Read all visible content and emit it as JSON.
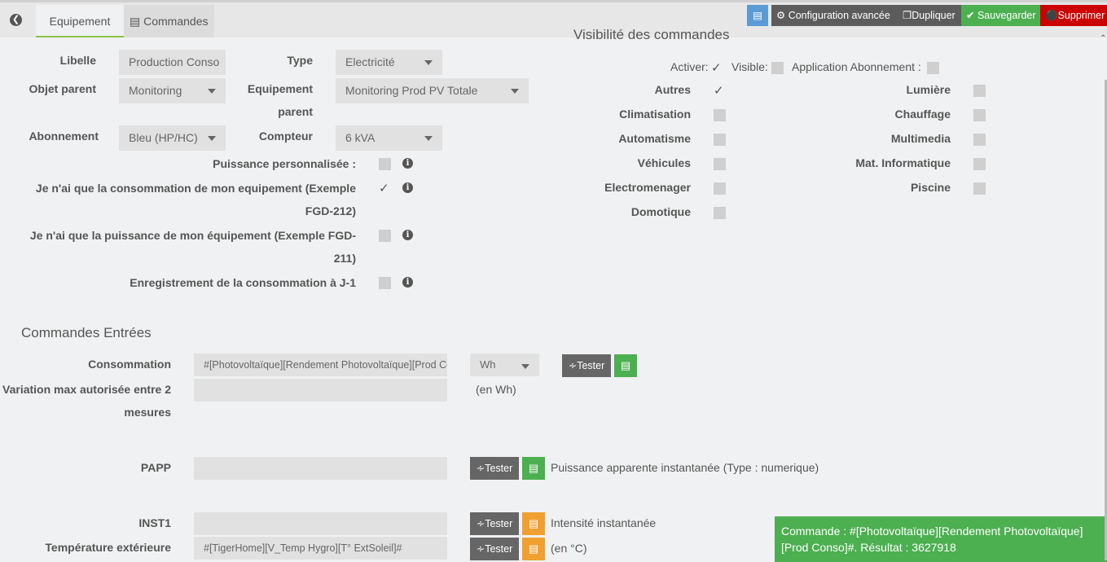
{
  "tabs": {
    "equipement": "Equipement",
    "commandes": "Commandes"
  },
  "toolbar": {
    "config": "Configuration avancée",
    "dupliquer": "Dupliquer",
    "sauvegarder": "Sauvegarder",
    "supprimer": "Supprimer"
  },
  "form": {
    "libelle_label": "Libelle",
    "libelle_value": "Production Conso",
    "type_label": "Type",
    "type_value": "Electricité",
    "objet_label": "Objet parent",
    "objet_value": "Monitoring",
    "equip_label1": "Equipement",
    "equip_label2": "parent",
    "equip_value": "Monitoring Prod PV Totale",
    "abonnement_label": "Abonnement",
    "abonnement_value": "Bleu (HP/HC)",
    "compteur_label": "Compteur",
    "compteur_value": "6 kVA",
    "options": [
      {
        "l1": "Puissance personnalisée :",
        "l2": "",
        "checked": false
      },
      {
        "l1": "Je n'ai que la consommation de mon equipement (Exemple",
        "l2": "FGD-212)",
        "checked": true
      },
      {
        "l1": "Je n'ai que la puissance de mon équipement (Exemple FGD-",
        "l2": "211)",
        "checked": false
      },
      {
        "l1": "Enregistrement de la consommation à J-1",
        "l2": "",
        "checked": false
      }
    ]
  },
  "visibility": {
    "title": "Visibilité des commandes",
    "activer": "Activer:",
    "visible": "Visible:",
    "application": "Application Abonnement :",
    "left": [
      "Autres",
      "Climatisation",
      "Automatisme",
      "Véhicules",
      "Electromenager",
      "Domotique"
    ],
    "right": [
      "Lumière",
      "Chauffage",
      "Multimedia",
      "Mat. Informatique",
      "Piscine"
    ]
  },
  "commandes": {
    "title": "Commandes Entrées",
    "tester": "Tester",
    "consommation_label": "Consommation",
    "consommation_value": "#[Photovoltaïque][Rendement Photovoltaïque][Prod Conso]#",
    "unit": "Wh",
    "variation_label1": "Variation max autorisée entre 2",
    "variation_label2": "mesures",
    "variation_note": "(en Wh)",
    "papp_label": "PAPP",
    "papp_note": "Puissance apparente instantanée (Type : numerique)",
    "inst1_label": "INST1",
    "inst1_note": "Intensité instantanée",
    "temp_label": "Température extérieure",
    "temp_value": "#[TigerHome][V_Temp  Hygro][T° ExtSoleil]#",
    "temp_note": "(en °C)"
  },
  "toast": {
    "line1": "Commande : #[Photovoltaïque][Rendement Photovoltaïque]",
    "line2": "[Prod Conso]#. Résultat : 3627918"
  },
  "colors": {
    "green": "#4caf50",
    "red": "#c00",
    "orange": "#f0a030",
    "blue": "#5b9bd5",
    "dark": "#5c5c5c"
  }
}
